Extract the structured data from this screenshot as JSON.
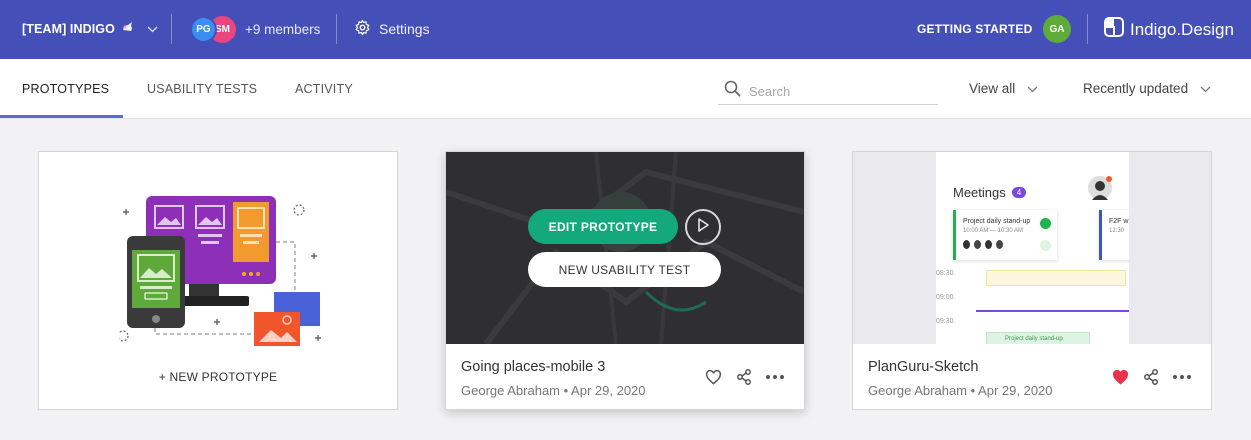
{
  "topbar": {
    "team_name": "[TEAM] INDIGO",
    "avatars": [
      "PG",
      "SM"
    ],
    "members_label": "+9 members",
    "settings_label": "Settings",
    "getting_started": "GETTING STARTED",
    "user_initials": "GA",
    "brand": "Indigo.Design"
  },
  "tabs": [
    "PROTOTYPES",
    "USABILITY TESTS",
    "ACTIVITY"
  ],
  "search": {
    "placeholder": "Search"
  },
  "filters": {
    "view": "View all",
    "sort": "Recently updated"
  },
  "new_card": {
    "label": "+ NEW PROTOTYPE"
  },
  "cards": [
    {
      "title": "Going places-mobile 3",
      "meta": "George Abraham • Apr 29, 2020",
      "edit_label": "EDIT PROTOTYPE",
      "usability_label": "NEW USABILITY TEST",
      "liked": false
    },
    {
      "title": "PlanGuru-Sketch",
      "meta": "George Abraham • Apr 29, 2020",
      "liked": true,
      "preview": {
        "heading": "Meetings",
        "count": "4",
        "event1_title": "Project daily stand-up",
        "event1_time": "10:00 AM — 10:30 AM",
        "event2_title": "F2F w",
        "event2_time": "12:30",
        "times": [
          "08:30",
          "09:00",
          "09:30"
        ],
        "event3_title": "Project daily stand-up"
      }
    }
  ],
  "colors": {
    "topbar": "#4450b7",
    "accent_green": "#13a97c",
    "like_red": "#e8334a"
  }
}
